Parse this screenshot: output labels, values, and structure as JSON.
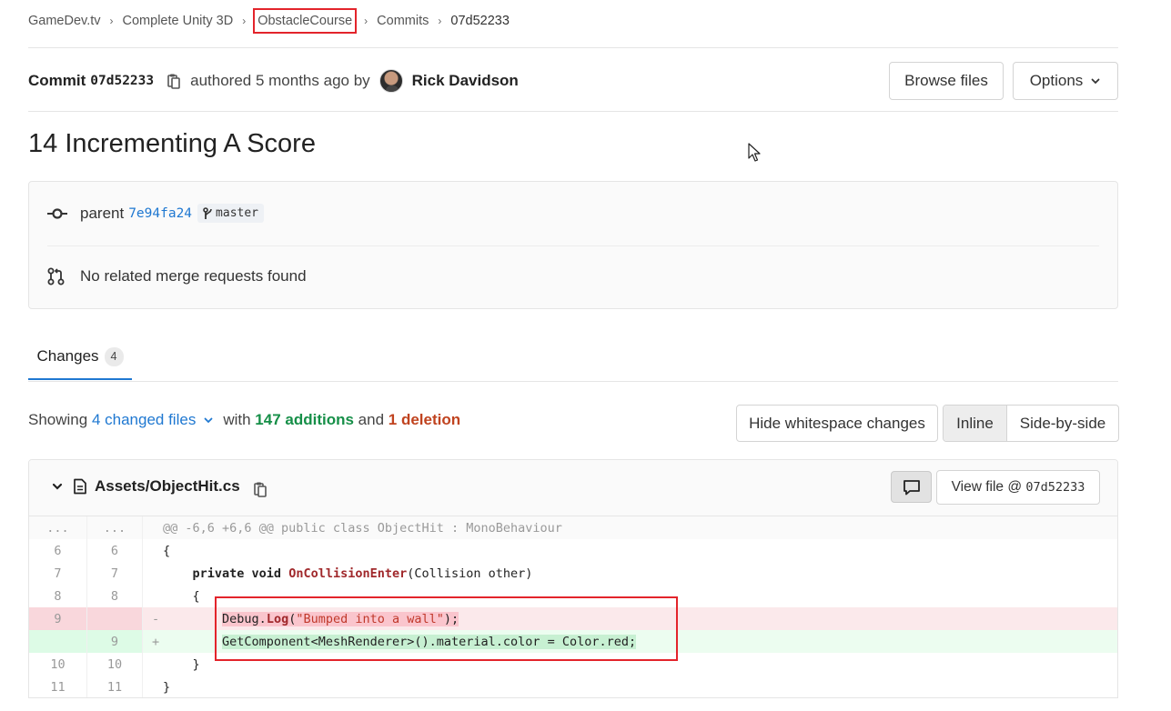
{
  "breadcrumb": {
    "items": [
      "GameDev.tv",
      "Complete Unity 3D",
      "ObstacleCourse",
      "Commits"
    ],
    "current": "07d52233",
    "separator": "›"
  },
  "commit": {
    "label": "Commit",
    "sha": "07d52233",
    "authored_text": "authored 5 months ago by",
    "author": "Rick Davidson",
    "title": "14 Incrementing A Score"
  },
  "buttons": {
    "browse_files": "Browse files",
    "options": "Options"
  },
  "info": {
    "parent_label": "parent",
    "parent_sha": "7e94fa24",
    "branch": "master",
    "merge_requests": "No related merge requests found"
  },
  "tabs": {
    "changes_label": "Changes",
    "changes_count": "4"
  },
  "summary": {
    "showing": "Showing",
    "changed_files": "4 changed files",
    "with": "with",
    "additions": "147 additions",
    "and": "and",
    "deletions": "1 deletion"
  },
  "view_controls": {
    "hide_whitespace": "Hide whitespace changes",
    "inline": "Inline",
    "side_by_side": "Side-by-side"
  },
  "file": {
    "path": "Assets/ObjectHit.cs",
    "view_file_prefix": "View file @ ",
    "view_file_sha": "07d52233"
  },
  "diff": {
    "hunk_old": "...",
    "hunk_new": "...",
    "hunk_header": "@@ -6,6 +6,6 @@ public class ObjectHit : MonoBehaviour",
    "lines": [
      {
        "old": "6",
        "new": "6",
        "sign": "",
        "text": "{"
      },
      {
        "old": "7",
        "new": "7",
        "sign": "",
        "pre": "    ",
        "kw": "private void ",
        "fn": "OnCollisionEnter",
        "rest": "(Collision other)"
      },
      {
        "old": "8",
        "new": "8",
        "sign": "",
        "text": "    {"
      },
      {
        "old": "9",
        "new": "",
        "sign": "-",
        "pre": "        ",
        "obj": "Debug.",
        "fn": "Log",
        "open": "(",
        "str": "\"Bumped into a wall\"",
        "close": ");"
      },
      {
        "old": "",
        "new": "9",
        "sign": "+",
        "pre": "        ",
        "text": "GetComponent<MeshRenderer>().material.color = Color.red;"
      },
      {
        "old": "10",
        "new": "10",
        "sign": "",
        "text": "    }"
      },
      {
        "old": "11",
        "new": "11",
        "sign": "",
        "text": "}"
      }
    ]
  },
  "colors": {
    "accent": "#1f78d1",
    "annotation": "#e3242b",
    "addition": "#168f48",
    "deletion": "#c0431f"
  }
}
